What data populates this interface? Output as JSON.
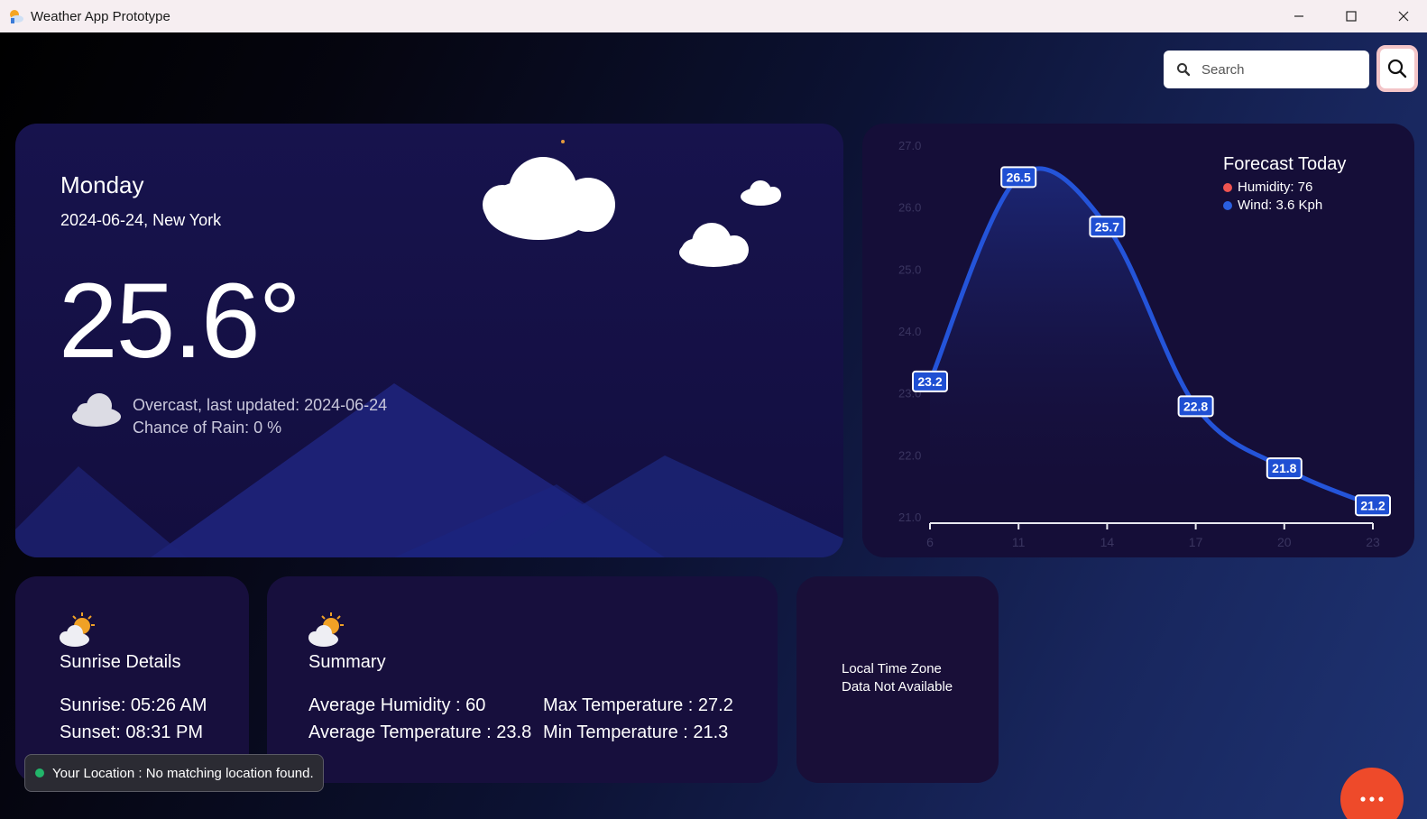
{
  "window": {
    "title": "Weather App Prototype"
  },
  "search": {
    "placeholder": "Search"
  },
  "current": {
    "day": "Monday",
    "date_location": "2024-06-24, New York",
    "temperature": "25.6°",
    "condition": "Overcast, last updated: 2024-06-24",
    "rain": "Chance of Rain: 0 %"
  },
  "forecast": {
    "legend_title": "Forecast Today",
    "humidity_label": "Humidity: 76",
    "wind_label": "Wind: 3.6 Kph",
    "colors": {
      "humidity": "#ef5350",
      "wind": "#2a5fe0"
    }
  },
  "chart_data": {
    "type": "line",
    "title": "Forecast Today",
    "x": [
      6,
      11,
      14,
      17,
      20,
      23
    ],
    "x_ticks": [
      "6",
      "11",
      "14",
      "17",
      "20",
      "23"
    ],
    "y_ticks": [
      "21.0",
      "22.0",
      "23.0",
      "24.0",
      "25.0",
      "26.0",
      "27.0"
    ],
    "ylim": [
      21,
      27
    ],
    "series": [
      {
        "values": [
          23.2,
          26.5,
          25.7,
          22.8,
          21.8,
          21.2
        ],
        "labels": [
          "23.2",
          "26.5",
          "25.7",
          "22.8",
          "21.8",
          "21.2"
        ]
      }
    ],
    "legend": [
      "Humidity: 76",
      "Wind: 3.6 Kph"
    ],
    "legend_position": "top-right",
    "grid": false
  },
  "sunrise": {
    "title": "Sunrise Details",
    "sunrise": "Sunrise: 05:26 AM",
    "sunset": "Sunset: 08:31 PM"
  },
  "summary": {
    "title": "Summary",
    "avg_humidity": "Average Humidity : 60",
    "avg_temperature": "Average Temperature : 23.8",
    "max_temperature": "Max Temperature : 27.2",
    "min_temperature": "Min Temperature : 21.3"
  },
  "timezone": {
    "line1": "Local Time Zone",
    "line2": "Data Not Available"
  },
  "toast": {
    "text": "Your Location : No matching location found."
  },
  "icons": {
    "app": "weather-app-icon",
    "search": "search-icon",
    "menu": "more-dots-icon"
  }
}
